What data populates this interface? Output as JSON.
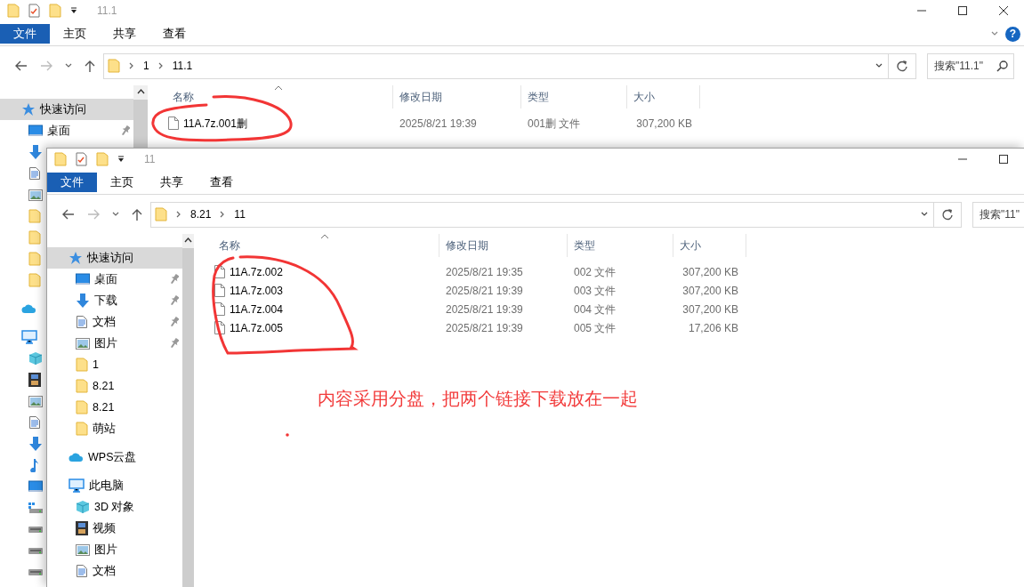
{
  "windows": [
    {
      "title": "11.1",
      "window_controls": [
        {
          "kind": "minimize"
        },
        {
          "kind": "maximize"
        },
        {
          "kind": "close"
        }
      ],
      "ribbon_tabs": [
        {
          "label": "文件",
          "selected": true
        },
        {
          "label": "主页",
          "selected": false
        },
        {
          "label": "共享",
          "selected": false
        },
        {
          "label": "查看",
          "selected": false
        }
      ],
      "help": "?",
      "path": [
        "1",
        "11.1"
      ],
      "search": {
        "placeholder": "搜索\"11.1\"",
        "icon": true
      },
      "nav": [
        {
          "kind": "quick",
          "label": "快速访问",
          "selected": true,
          "children": [
            {
              "kind": "desktop",
              "label": "桌面",
              "selected": false,
              "pinned": true
            },
            {
              "kind": "download",
              "selected": false
            },
            {
              "kind": "docs",
              "selected": false
            },
            {
              "kind": "pictures",
              "selected": false
            },
            {
              "kind": "folder",
              "selected": false
            },
            {
              "kind": "folder",
              "selected": false
            },
            {
              "kind": "folder",
              "selected": false
            },
            {
              "kind": "folder",
              "selected": false
            }
          ]
        },
        {
          "kind": "cloud",
          "selected": false
        },
        {
          "kind": "pc",
          "selected": false,
          "children": [
            {
              "kind": "cube",
              "selected": false
            },
            {
              "kind": "video",
              "selected": false
            },
            {
              "kind": "pictures",
              "selected": false
            },
            {
              "kind": "docs",
              "selected": false
            },
            {
              "kind": "download",
              "selected": false
            },
            {
              "kind": "music",
              "selected": false
            },
            {
              "kind": "desktop",
              "selected": false
            },
            {
              "kind": "drive-win",
              "selected": false
            },
            {
              "kind": "drive",
              "selected": false
            },
            {
              "kind": "drive",
              "selected": false
            },
            {
              "kind": "drive",
              "selected": false
            }
          ]
        }
      ],
      "columns": [
        "名称",
        "修改日期",
        "类型",
        "大小"
      ],
      "files": [
        {
          "name": "11A.7z.001删",
          "modified": "2025/8/21 19:39",
          "type": "001删 文件",
          "size": "307,200 KB"
        }
      ]
    },
    {
      "title": "11",
      "window_controls": [
        {
          "kind": "minimize"
        },
        {
          "kind": "maximize"
        }
      ],
      "ribbon_tabs": [
        {
          "label": "文件",
          "selected": true
        },
        {
          "label": "主页",
          "selected": false
        },
        {
          "label": "共享",
          "selected": false
        },
        {
          "label": "查看",
          "selected": false
        }
      ],
      "path": [
        "8.21",
        "11"
      ],
      "search": {
        "placeholder": "搜索\"11\"",
        "icon": false
      },
      "nav": [
        {
          "kind": "quick",
          "label": "快速访问",
          "selected": true,
          "children": [
            {
              "kind": "desktop",
              "label": "桌面",
              "selected": false,
              "pinned": true
            },
            {
              "kind": "download",
              "label": "下载",
              "selected": false,
              "pinned": true
            },
            {
              "kind": "docs",
              "label": "文档",
              "selected": false,
              "pinned": true
            },
            {
              "kind": "pictures",
              "label": "图片",
              "selected": false,
              "pinned": true
            },
            {
              "kind": "folder",
              "label": "1",
              "selected": false,
              "pinned": false
            },
            {
              "kind": "folder",
              "label": "8.21",
              "selected": false,
              "pinned": false
            },
            {
              "kind": "folder",
              "label": "8.21",
              "selected": false,
              "pinned": false
            },
            {
              "kind": "folder",
              "label": "萌站",
              "selected": false,
              "pinned": false
            }
          ]
        },
        {
          "kind": "cloud",
          "label": "WPS云盘",
          "selected": false
        },
        {
          "kind": "pc",
          "label": "此电脑",
          "selected": false,
          "children": [
            {
              "kind": "cube",
              "label": "3D 对象",
              "selected": false
            },
            {
              "kind": "video",
              "label": "视频",
              "selected": false
            },
            {
              "kind": "pictures",
              "label": "图片",
              "selected": false
            },
            {
              "kind": "docs",
              "label": "文档",
              "selected": false
            }
          ]
        }
      ],
      "columns": [
        "名称",
        "修改日期",
        "类型",
        "大小"
      ],
      "files": [
        {
          "name": "11A.7z.002",
          "modified": "2025/8/21 19:35",
          "type": "002 文件",
          "size": "307,200 KB"
        },
        {
          "name": "11A.7z.003",
          "modified": "2025/8/21 19:39",
          "type": "003 文件",
          "size": "307,200 KB"
        },
        {
          "name": "11A.7z.004",
          "modified": "2025/8/21 19:39",
          "type": "004 文件",
          "size": "307,200 KB"
        },
        {
          "name": "11A.7z.005",
          "modified": "2025/8/21 19:39",
          "type": "005 文件",
          "size": "17,206 KB"
        }
      ]
    }
  ],
  "annotation": {
    "note": "内容采用分盘，把两个链接下载放在一起"
  }
}
